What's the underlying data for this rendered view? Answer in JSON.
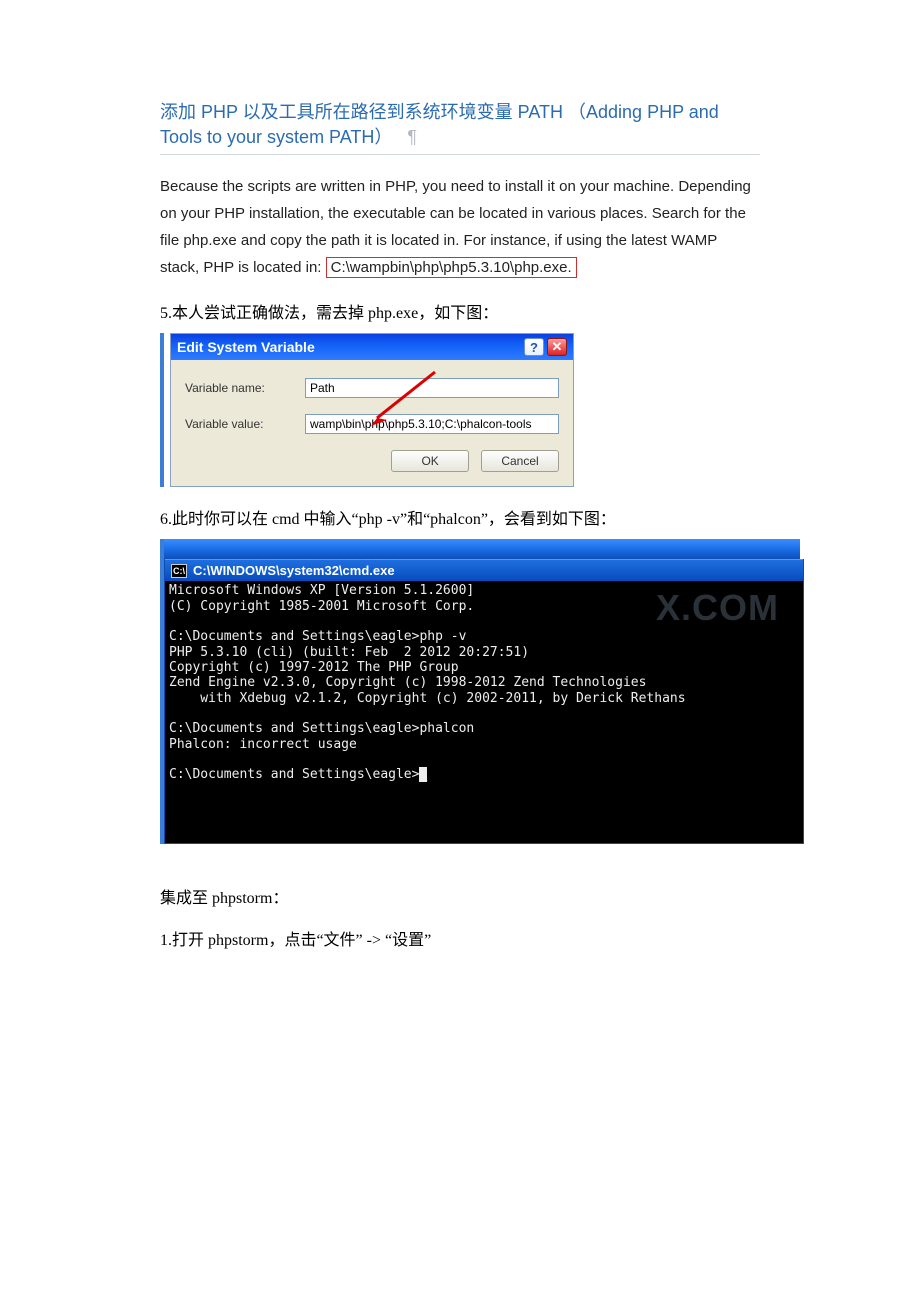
{
  "heading": {
    "title": "添加 PHP 以及工具所在路径到系统环境变量 PATH （Adding PHP and Tools to your system PATH）",
    "pilcrow": "¶"
  },
  "intro_before": "Because the scripts are written in PHP, you need to install it on your machine. Depending on your PHP installation, the executable can be located in various places. Search for the file php.exe and copy the path it is located in. For instance, if using the latest WAMP stack, PHP is located in:",
  "intro_highlight": " C:\\wampbin\\php\\php5.3.10\\php.exe. ",
  "instr5": "5.本人尝试正确做法，需去掉 php.exe，如下图：",
  "dialog": {
    "title": "Edit System Variable",
    "help_glyph": "?",
    "close_glyph": "✕",
    "name_label": "Variable name:",
    "name_value": "Path",
    "value_label": "Variable value:",
    "value_value": "wamp\\bin\\php\\php5.3.10;C:\\phalcon-tools",
    "ok": "OK",
    "cancel": "Cancel"
  },
  "instr6": "6.此时你可以在 cmd 中输入“php -v”和“phalcon”，会看到如下图：",
  "cmd": {
    "icon": "C:\\",
    "title": "C:\\WINDOWS\\system32\\cmd.exe",
    "lines": [
      "Microsoft Windows XP [Version 5.1.2600]",
      "(C) Copyright 1985-2001 Microsoft Corp.",
      "",
      "C:\\Documents and Settings\\eagle>php -v",
      "PHP 5.3.10 (cli) (built: Feb  2 2012 20:27:51)",
      "Copyright (c) 1997-2012 The PHP Group",
      "Zend Engine v2.3.0, Copyright (c) 1998-2012 Zend Technologies",
      "    with Xdebug v2.1.2, Copyright (c) 2002-2011, by Derick Rethans",
      "",
      "C:\\Documents and Settings\\eagle>phalcon",
      "Phalcon: incorrect usage",
      "",
      "C:\\Documents and Settings\\eagle>"
    ],
    "watermark": "X.COM"
  },
  "integrate_heading": "集成至 phpstorm：",
  "integrate_step1": "1.打开 phpstorm，点击“文件” -> “设置”"
}
